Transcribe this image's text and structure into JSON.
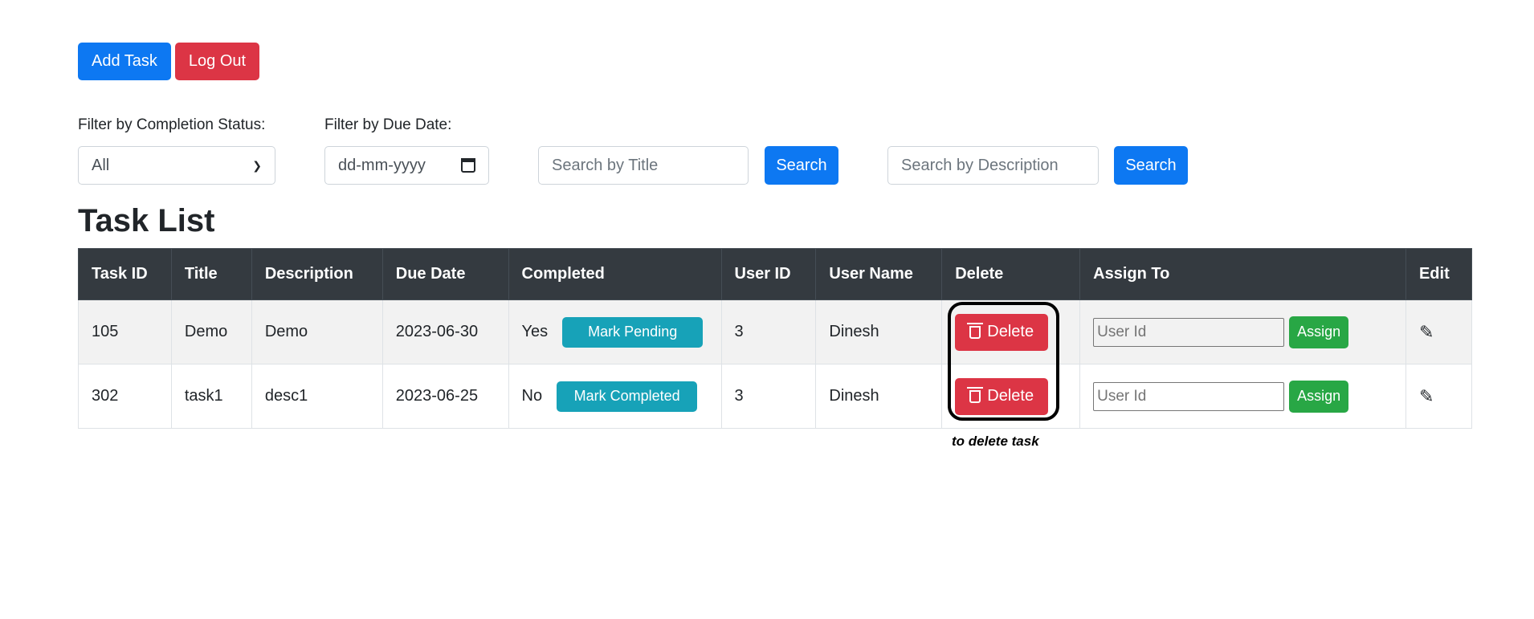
{
  "actions": {
    "add_task": "Add Task",
    "log_out": "Log Out"
  },
  "filters": {
    "status_label": "Filter by Completion Status:",
    "status_value": "All",
    "date_label": "Filter by Due Date:",
    "date_placeholder": "dd-mm-yyyy",
    "title_search_placeholder": "Search by Title",
    "title_search_button": "Search",
    "desc_search_placeholder": "Search by Description",
    "desc_search_button": "Search"
  },
  "page_title": "Task List",
  "table": {
    "headers": [
      "Task ID",
      "Title",
      "Description",
      "Due Date",
      "Completed",
      "User ID",
      "User Name",
      "Delete",
      "Assign To",
      "Edit"
    ],
    "rows": [
      {
        "task_id": "105",
        "title": "Demo",
        "description": "Demo",
        "due_date": "2023-06-30",
        "completed": "Yes",
        "toggle_label": "Mark Pending",
        "user_id": "3",
        "user_name": "Dinesh",
        "delete_label": "Delete",
        "assign_placeholder": "User Id",
        "assign_label": "Assign"
      },
      {
        "task_id": "302",
        "title": "task1",
        "description": "desc1",
        "due_date": "2023-06-25",
        "completed": "No",
        "toggle_label": "Mark Completed",
        "user_id": "3",
        "user_name": "Dinesh",
        "delete_label": "Delete",
        "assign_placeholder": "User Id",
        "assign_label": "Assign"
      }
    ]
  },
  "annotation": {
    "text": "to delete task"
  },
  "icons": {
    "delete": "trash-icon",
    "edit": "pencil-icon",
    "dropdown": "chevron-down-icon",
    "date": "calendar-icon"
  },
  "colors": {
    "primary": "#0d78f2",
    "danger": "#dc3545",
    "info": "#17a2b8",
    "success": "#28a745",
    "header_bg": "#343a40"
  }
}
